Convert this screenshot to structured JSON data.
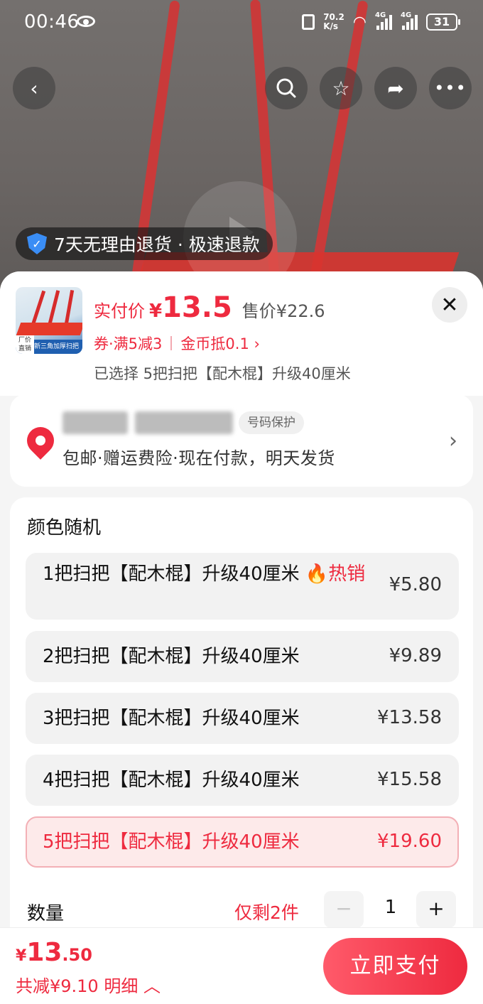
{
  "status_bar": {
    "time": "00:46",
    "speed_top": "70.2",
    "speed_bottom": "K/s",
    "network_1": "4G",
    "network_2": "4G",
    "battery": "31"
  },
  "hero": {
    "refund_badge": "7天无理由退货 · 极速退款"
  },
  "product": {
    "pay_label": "实付价",
    "currency": "¥",
    "pay_price": "13.5",
    "original_price": "售价¥22.6",
    "coupon": "券·满5减3",
    "coins": "金币抵0.1 ›",
    "selected": "已选择 5把扫把【配木棍】升级40厘米",
    "thumb_factory": "厂价直销",
    "thumb_caption": "新三角加厚扫把"
  },
  "address": {
    "privacy_tag": "号码保护",
    "shipping": "包邮·赠运费险·现在付款，明天发货"
  },
  "options": {
    "title": "颜色随机",
    "items": [
      {
        "name": "1把扫把【配木棍】升级40厘米",
        "badge": "🔥热销",
        "price": "¥5.80"
      },
      {
        "name": "2把扫把【配木棍】升级40厘米",
        "price": "¥9.89"
      },
      {
        "name": "3把扫把【配木棍】升级40厘米",
        "price": "¥13.58"
      },
      {
        "name": "4把扫把【配木棍】升级40厘米",
        "price": "¥15.58"
      },
      {
        "name": "5把扫把【配木棍】升级40厘米",
        "price": "¥19.60"
      }
    ]
  },
  "quantity": {
    "label": "数量",
    "stock_note": "仅剩2件",
    "minus": "−",
    "value": "1",
    "plus": "+"
  },
  "footer": {
    "currency": "¥",
    "total_int": "13",
    "total_dec": ".50",
    "saved": "共减¥9.10 明细 ︿",
    "pay_button": "立即支付"
  }
}
